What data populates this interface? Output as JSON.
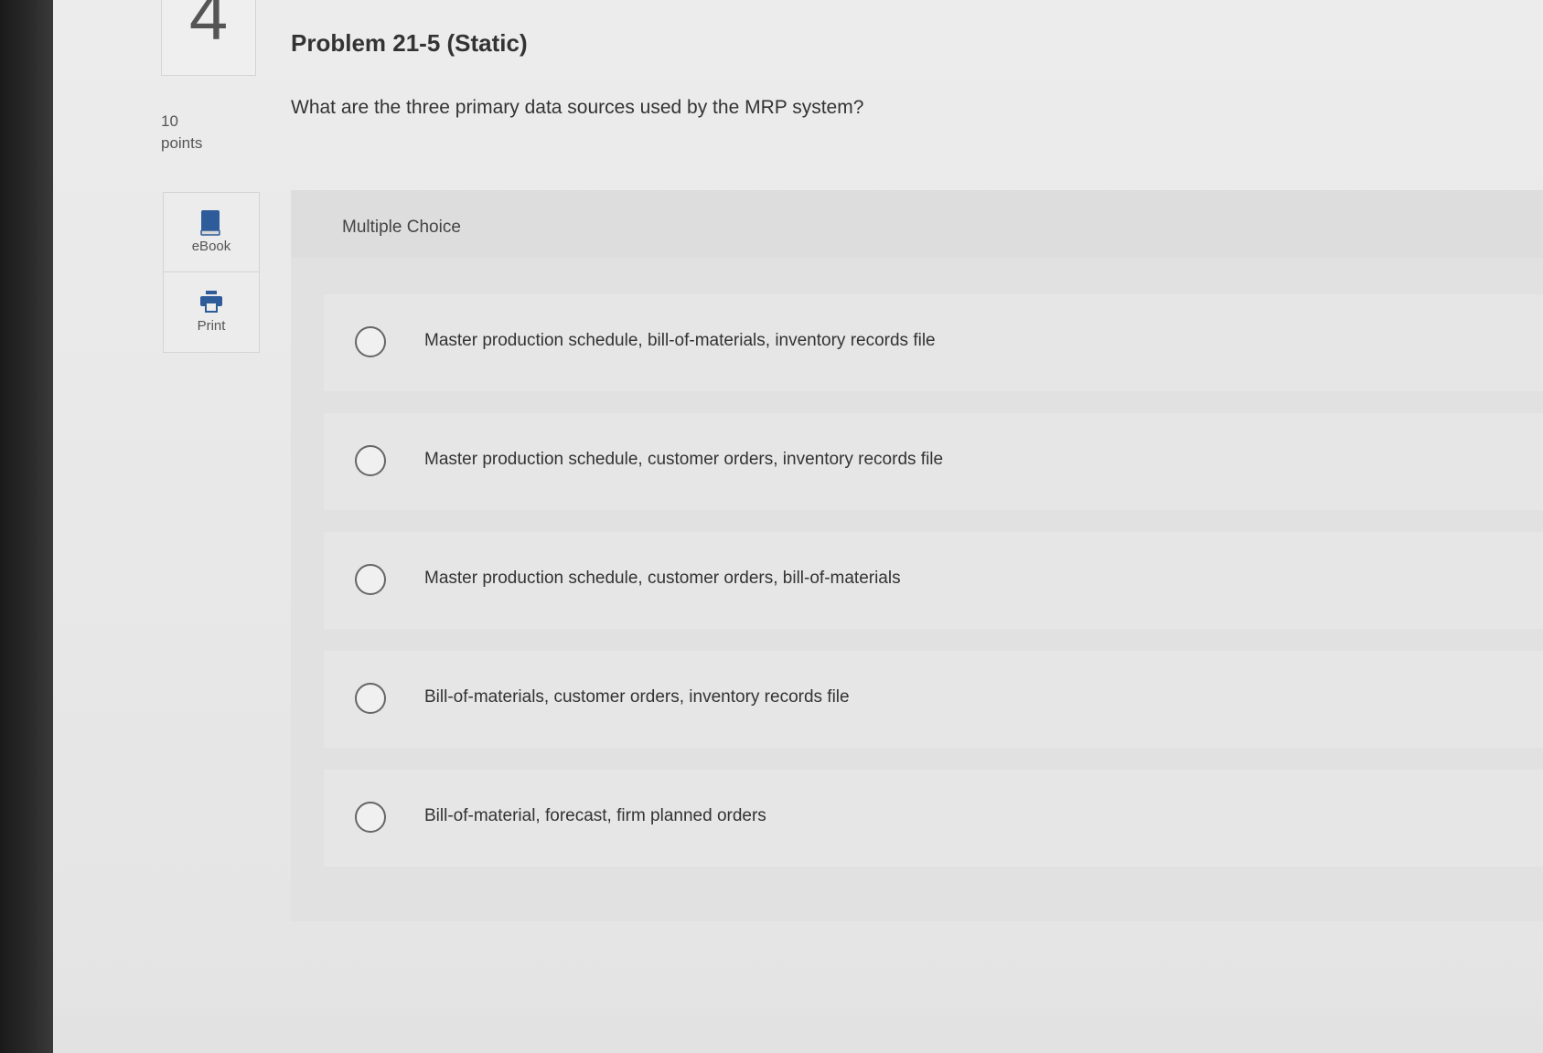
{
  "question": {
    "number": "4",
    "points_value": "10",
    "points_label": "points",
    "title": "Problem 21-5 (Static)",
    "text": "What are the three primary data sources used by the MRP system?"
  },
  "tools": [
    {
      "label": "eBook",
      "icon": "book-icon"
    },
    {
      "label": "Print",
      "icon": "printer-icon"
    }
  ],
  "answer_panel": {
    "type_label": "Multiple Choice",
    "options": [
      {
        "text": "Master production schedule, bill-of-materials, inventory records file",
        "selected": false
      },
      {
        "text": "Master production schedule, customer orders, inventory records file",
        "selected": false
      },
      {
        "text": "Master production schedule, customer orders, bill-of-materials",
        "selected": false
      },
      {
        "text": "Bill-of-materials, customer orders, inventory records file",
        "selected": false
      },
      {
        "text": "Bill-of-material, forecast, firm planned orders",
        "selected": false
      }
    ]
  },
  "colors": {
    "icon_blue": "#2e5c9a",
    "panel_bg": "#e1e1e1",
    "text": "#333333"
  }
}
